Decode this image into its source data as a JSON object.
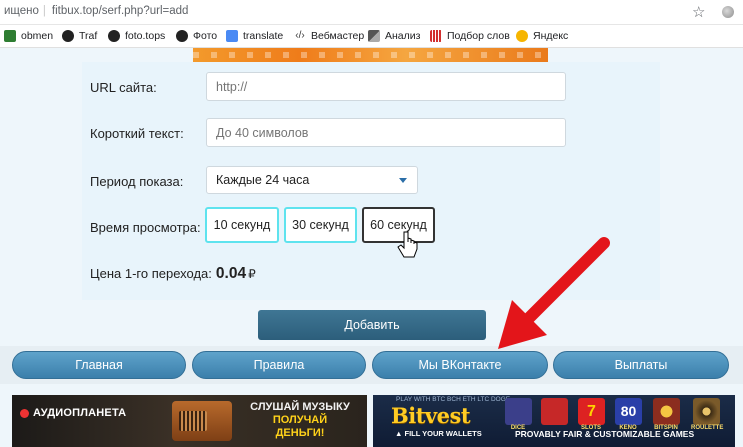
{
  "browser": {
    "security_text": "ищено",
    "url": "fitbux.top/serf.php?url=add",
    "bookmarks": [
      {
        "label": "obmen",
        "icon": "bookmark-app-icon"
      },
      {
        "label": "Traf",
        "icon": "github-icon"
      },
      {
        "label": "foto.tops",
        "icon": "github-icon"
      },
      {
        "label": "Фото",
        "icon": "github-icon"
      },
      {
        "label": "translate",
        "icon": "translate-icon"
      },
      {
        "label": "Вебмастер",
        "icon": "code-icon"
      },
      {
        "label": "Анализ",
        "icon": "analysis-icon"
      },
      {
        "label": "Подбор слов",
        "icon": "bar-chart-icon"
      },
      {
        "label": "Яндекс",
        "icon": "yandex-icon"
      }
    ]
  },
  "form": {
    "url_label": "URL сайта:",
    "url_placeholder": "http://",
    "short_text_label": "Короткий текст:",
    "short_text_placeholder": "До 40 символов",
    "period_label": "Период показа:",
    "period_value": "Каждые 24 часа",
    "view_time_label": "Время просмотра:",
    "view_time_options": [
      "10 секунд",
      "30 секунд",
      "60 секунд"
    ],
    "price_label": "Цена 1-го перехода:",
    "price_value": "0.04",
    "price_currency": "₽",
    "submit_label": "Добавить"
  },
  "nav": {
    "items": [
      "Главная",
      "Правила",
      "Мы ВКонтакте",
      "Выплаты"
    ]
  },
  "ads": {
    "audio": {
      "logo": "АУДИОПЛАНЕТА",
      "line1": "СЛУШАЙ МУЗЫКУ",
      "line2": "ПОЛУЧАЙ",
      "line3": "ДЕНЬГИ!"
    },
    "bitvest": {
      "top": "PLAY WITH BTC BCH ETH LTC DOGE",
      "brand": "Bitvest",
      "sub": "▲ FILL YOUR WALLETS",
      "provably": "PROVABLY FAIR & CUSTOMIZABLE GAMES",
      "games": [
        "DICE",
        "SLOTS",
        "KENO",
        "BITSPIN",
        "ROULETTE"
      ],
      "keno_number": "80"
    }
  },
  "colors": {
    "accent_cyan": "#5ee3ee",
    "nav_blue": "#3b7fab",
    "submit_blue": "#2c5e7b",
    "arrow_red": "#e3151a"
  }
}
